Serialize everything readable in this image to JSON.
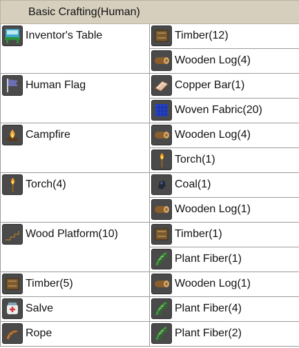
{
  "header": {
    "title": "Basic Crafting(Human)"
  },
  "recipes": [
    {
      "product": {
        "label": "Inventor's Table",
        "icon": "inventors-table-icon"
      },
      "ingredients": [
        {
          "label": "Timber(12)",
          "icon": "timber-icon"
        },
        {
          "label": "Wooden Log(4)",
          "icon": "wooden-log-icon"
        }
      ]
    },
    {
      "product": {
        "label": "Human Flag",
        "icon": "human-flag-icon"
      },
      "ingredients": [
        {
          "label": "Copper Bar(1)",
          "icon": "copper-bar-icon"
        },
        {
          "label": "Woven Fabric(20)",
          "icon": "woven-fabric-icon"
        }
      ]
    },
    {
      "product": {
        "label": "Campfire",
        "icon": "campfire-icon"
      },
      "ingredients": [
        {
          "label": "Wooden Log(4)",
          "icon": "wooden-log-icon"
        },
        {
          "label": "Torch(1)",
          "icon": "torch-icon"
        }
      ]
    },
    {
      "product": {
        "label": "Torch(4)",
        "icon": "torch-icon"
      },
      "ingredients": [
        {
          "label": "Coal(1)",
          "icon": "coal-icon"
        },
        {
          "label": "Wooden Log(1)",
          "icon": "wooden-log-icon"
        }
      ]
    },
    {
      "product": {
        "label": "Wood Platform(10)",
        "icon": "wood-platform-icon"
      },
      "ingredients": [
        {
          "label": "Timber(1)",
          "icon": "timber-icon"
        },
        {
          "label": "Plant Fiber(1)",
          "icon": "plant-fiber-icon"
        }
      ]
    },
    {
      "product": {
        "label": "Timber(5)",
        "icon": "timber-icon"
      },
      "ingredients": [
        {
          "label": "Wooden Log(1)",
          "icon": "wooden-log-icon"
        }
      ]
    },
    {
      "product": {
        "label": "Salve",
        "icon": "salve-icon"
      },
      "ingredients": [
        {
          "label": "Plant Fiber(4)",
          "icon": "plant-fiber-icon"
        }
      ]
    },
    {
      "product": {
        "label": "Rope",
        "icon": "rope-icon"
      },
      "ingredients": [
        {
          "label": "Plant Fiber(2)",
          "icon": "plant-fiber-icon"
        }
      ]
    }
  ]
}
